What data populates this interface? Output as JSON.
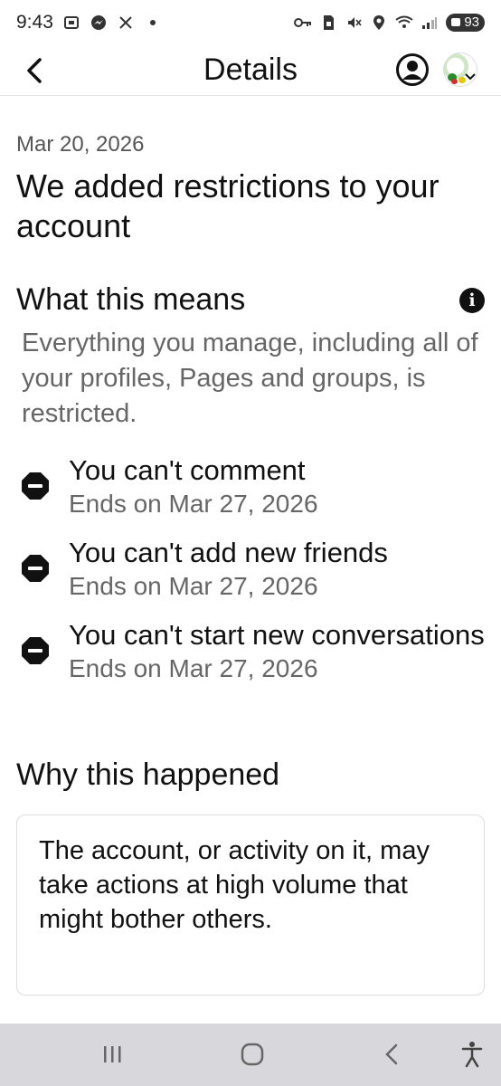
{
  "status_bar": {
    "time": "9:43",
    "battery": "93"
  },
  "header": {
    "title": "Details"
  },
  "notice": {
    "date": "Mar 20, 2026",
    "headline": "We added restrictions to your account"
  },
  "what_this_means": {
    "title": "What this means",
    "description": "Everything you manage, including all of your profiles, Pages and groups, is restricted.",
    "restrictions": [
      {
        "title": "You can't comment",
        "ends": "Ends on Mar 27, 2026"
      },
      {
        "title": "You can't add new friends",
        "ends": "Ends on Mar 27, 2026"
      },
      {
        "title": "You can't start new conversations",
        "ends": "Ends on Mar 27, 2026"
      }
    ]
  },
  "why": {
    "title": "Why this happened",
    "text": "The account, or activity on it, may take actions at high volume that might bother others."
  },
  "icons": {
    "back": "back-arrow-icon",
    "account": "account-circle-icon",
    "info": "info-icon",
    "restriction": "no-entry-icon",
    "nav_recents": "recents-icon",
    "nav_home": "home-icon",
    "nav_back": "back-icon",
    "nav_accessibility": "accessibility-icon"
  },
  "colors": {
    "text_primary": "#111111",
    "text_secondary": "#666666",
    "nav_bar": "#d8d8dc"
  }
}
